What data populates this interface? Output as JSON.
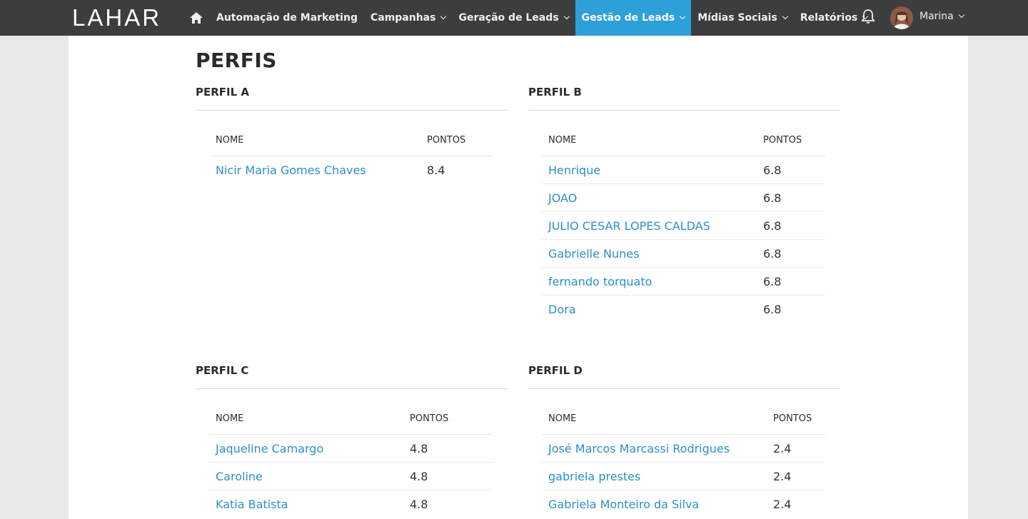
{
  "brand": {
    "logo": "LAHAR"
  },
  "nav": {
    "items": [
      {
        "label": "Automação de Marketing",
        "dropdown": false,
        "active": false
      },
      {
        "label": "Campanhas",
        "dropdown": true,
        "active": false
      },
      {
        "label": "Geração de Leads",
        "dropdown": true,
        "active": false
      },
      {
        "label": "Gestão de Leads",
        "dropdown": true,
        "active": true
      },
      {
        "label": "Mídias Sociais",
        "dropdown": true,
        "active": false
      },
      {
        "label": "Relatórios",
        "dropdown": true,
        "active": false
      }
    ],
    "user_name": "Marina"
  },
  "colors": {
    "topbar": "#3d3d3d",
    "active_nav": "#2d9fd9",
    "link": "#2d8fc8"
  },
  "page": {
    "title": "PERFIS"
  },
  "profiles": [
    {
      "title": "PERFIL A",
      "col_name": "NOME",
      "col_points": "PONTOS",
      "rows": [
        {
          "name": "Nicir Maria Gomes Chaves",
          "points": "8.4"
        }
      ]
    },
    {
      "title": "PERFIL B",
      "col_name": "NOME",
      "col_points": "PONTOS",
      "rows": [
        {
          "name": "Henrique",
          "points": "6.8"
        },
        {
          "name": "JOAO",
          "points": "6.8"
        },
        {
          "name": "JULIO CESAR LOPES CALDAS",
          "points": "6.8"
        },
        {
          "name": "Gabrielle Nunes",
          "points": "6.8"
        },
        {
          "name": "fernando torquato",
          "points": "6.8"
        },
        {
          "name": "Dora",
          "points": "6.8"
        }
      ]
    },
    {
      "title": "PERFIL C",
      "col_name": "NOME",
      "col_points": "PONTOS",
      "rows": [
        {
          "name": "Jaqueline Camargo",
          "points": "4.8"
        },
        {
          "name": "Caroline",
          "points": "4.8"
        },
        {
          "name": "Katia Batista",
          "points": "4.8"
        }
      ]
    },
    {
      "title": "PERFIL D",
      "col_name": "NOME",
      "col_points": "PONTOS",
      "rows": [
        {
          "name": "José Marcos Marcassi Rodrigues",
          "points": "2.4"
        },
        {
          "name": "gabriela prestes",
          "points": "2.4"
        },
        {
          "name": "Gabriela Monteiro da Silva",
          "points": "2.4"
        }
      ]
    }
  ]
}
